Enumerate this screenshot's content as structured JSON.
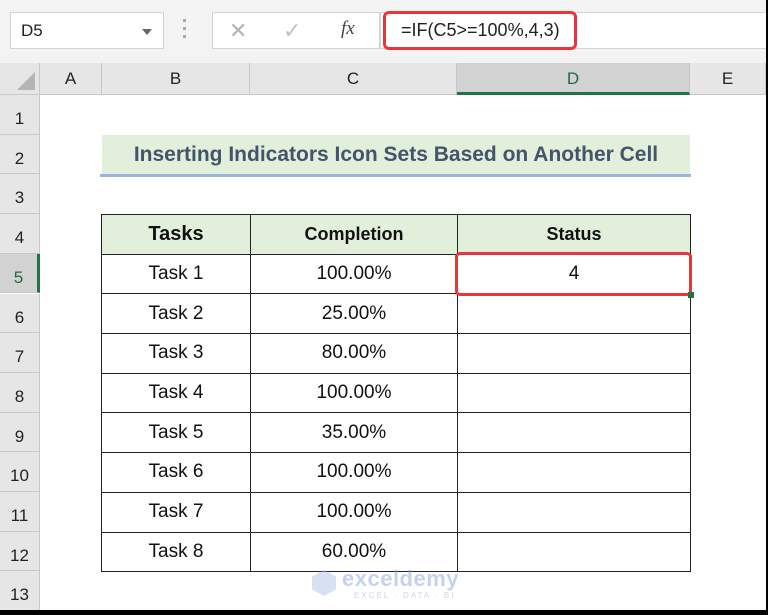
{
  "formula_bar": {
    "name_box": "D5",
    "cancel_icon": "✕",
    "enter_icon": "✓",
    "fx_label": "fx",
    "formula": "=IF(C5>=100%,4,3)"
  },
  "columns": [
    "A",
    "B",
    "C",
    "D",
    "E"
  ],
  "selected_column": "D",
  "rows": [
    "1",
    "2",
    "3",
    "4",
    "5",
    "6",
    "7",
    "8",
    "9",
    "10",
    "11",
    "12",
    "13"
  ],
  "selected_row": "5",
  "title": "Inserting Indicators Icon Sets Based on Another Cell",
  "table": {
    "headers": [
      "Tasks",
      "Completion",
      "Status"
    ],
    "rows": [
      {
        "task": "Task 1",
        "completion": "100.00%",
        "status": "4"
      },
      {
        "task": "Task 2",
        "completion": "25.00%",
        "status": ""
      },
      {
        "task": "Task 3",
        "completion": "80.00%",
        "status": ""
      },
      {
        "task": "Task 4",
        "completion": "100.00%",
        "status": ""
      },
      {
        "task": "Task 5",
        "completion": "35.00%",
        "status": ""
      },
      {
        "task": "Task 6",
        "completion": "100.00%",
        "status": ""
      },
      {
        "task": "Task 7",
        "completion": "100.00%",
        "status": ""
      },
      {
        "task": "Task 8",
        "completion": "60.00%",
        "status": ""
      }
    ]
  },
  "watermark": {
    "name": "exceldemy",
    "tagline": "EXCEL · DATA · BI"
  },
  "colors": {
    "highlight": "#e8343b",
    "selection": "#217346",
    "header_fill": "#e2efda",
    "title_text": "#44546a"
  }
}
